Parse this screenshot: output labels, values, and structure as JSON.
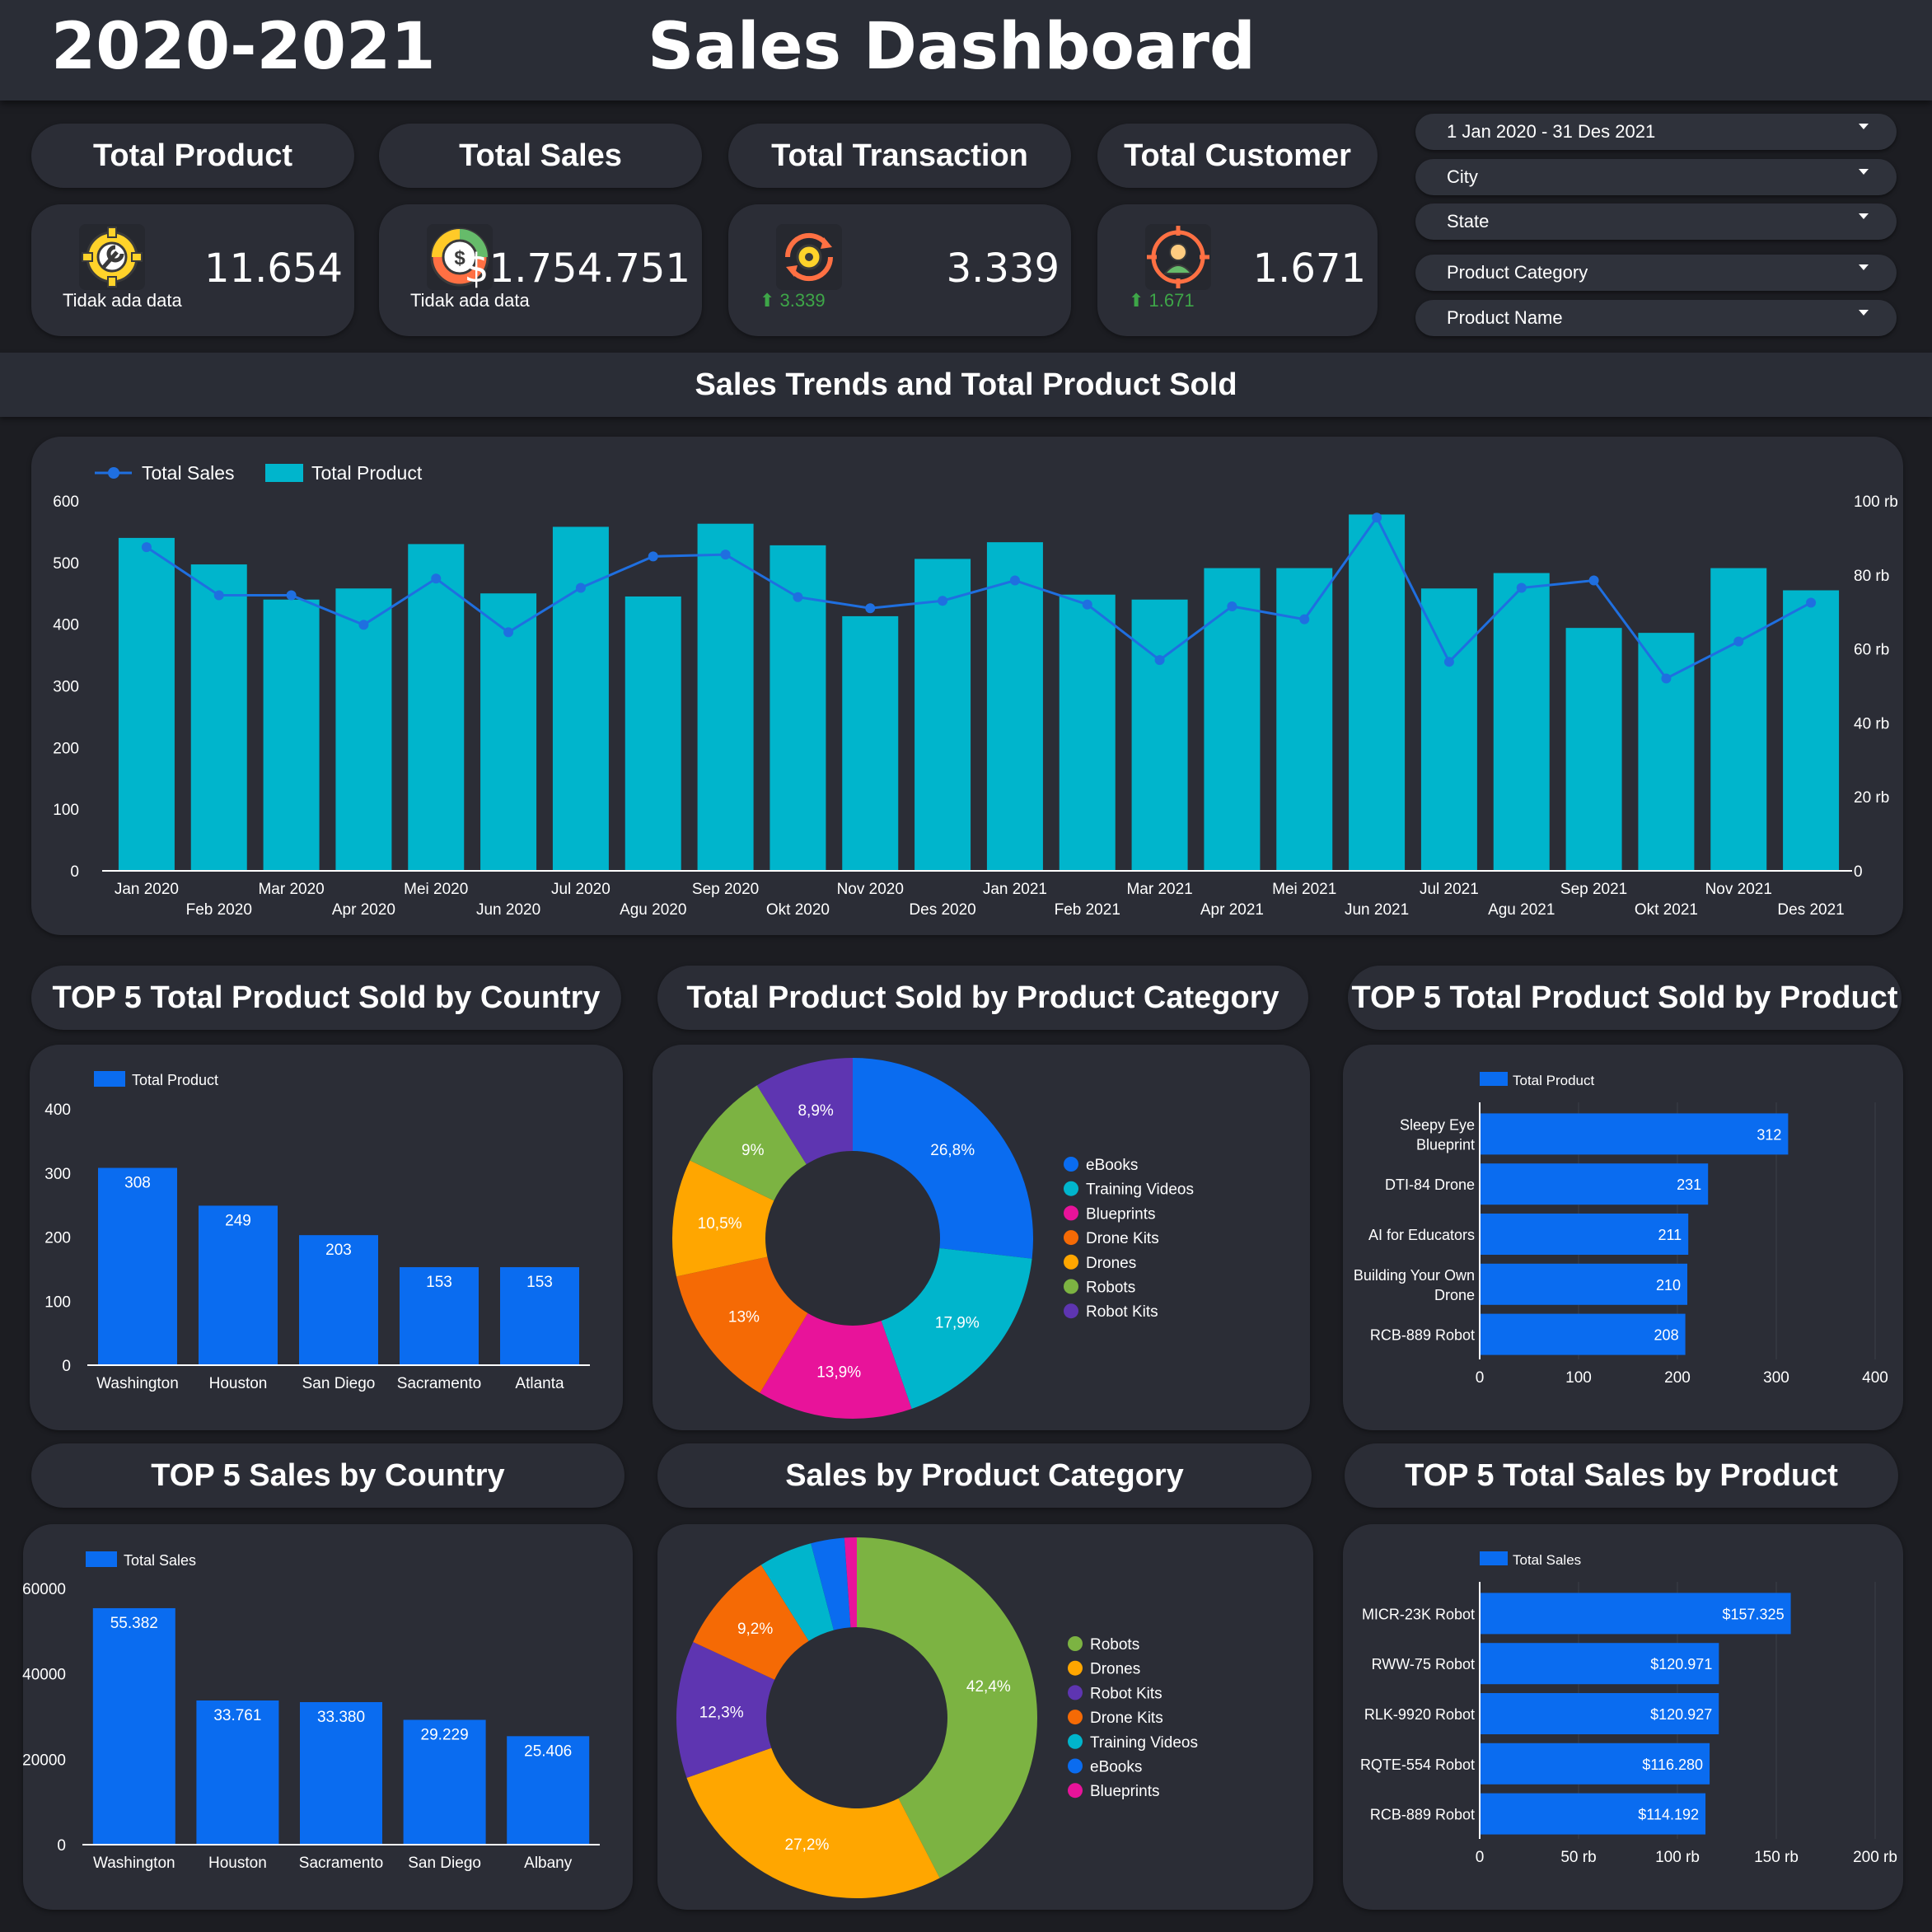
{
  "header": {
    "year": "2020-2021",
    "title": "Sales Dashboard"
  },
  "kpis": [
    {
      "title": "Total Product",
      "value": "11.654",
      "sub": "Tidak ada data",
      "icon": "gear-wrench-icon"
    },
    {
      "title": "Total Sales",
      "value": "$1.754.751",
      "sub": "Tidak ada data",
      "icon": "dollar-coin-icon"
    },
    {
      "title": "Total Transaction",
      "value": "3.339",
      "sub": "3.339",
      "icon": "gear-cycle-icon"
    },
    {
      "title": "Total Customer",
      "value": "1.671",
      "sub": "1.671",
      "icon": "customer-target-icon"
    }
  ],
  "filters": [
    "1 Jan 2020 - 31 Des 2021",
    "City",
    "State",
    "Product Category",
    "Product Name"
  ],
  "section_title": "Sales Trends and Total Product Sold",
  "colors": {
    "bar_cyan": "#00b5cc",
    "bar_blue": "#0a6cf0",
    "line_blue": "#1f6fe0",
    "card": "#2b2d36",
    "bg": "#1c1d22",
    "up_green": "#3ea648"
  },
  "chart_titles": {
    "country_product": "TOP 5 Total Product Sold by Country",
    "category_product": "Total Product Sold by  Product Category",
    "product_product": "TOP 5 Total Product Sold by Product",
    "country_sales": "TOP 5 Sales by Country",
    "category_sales": "Sales by Product Category",
    "product_sales": "TOP 5 Total Sales by Product"
  },
  "chart_data": [
    {
      "type": "bar",
      "legend": [
        "Total Sales",
        "Total Product"
      ],
      "categories": [
        "Jan 2020",
        "Feb 2020",
        "Mar 2020",
        "Apr 2020",
        "Mei 2020",
        "Jun 2020",
        "Jul 2020",
        "Agu 2020",
        "Sep 2020",
        "Okt 2020",
        "Nov 2020",
        "Des 2020",
        "Jan 2021",
        "Feb 2021",
        "Mar 2021",
        "Apr 2021",
        "Mei 2021",
        "Jun 2021",
        "Jul 2021",
        "Agu 2021",
        "Sep 2021",
        "Okt 2021",
        "Nov 2021",
        "Des 2021"
      ],
      "series": [
        {
          "name": "Total Product",
          "axis": "left",
          "values": [
            540,
            497,
            440,
            458,
            530,
            450,
            558,
            445,
            563,
            528,
            413,
            506,
            533,
            448,
            440,
            491,
            491,
            578,
            458,
            483,
            394,
            386,
            491,
            455
          ]
        },
        {
          "name": "Total Sales",
          "axis": "right",
          "values": [
            87500,
            74500,
            74500,
            66500,
            79000,
            64500,
            76500,
            85000,
            85500,
            74000,
            71000,
            73000,
            78500,
            72000,
            57000,
            71500,
            68000,
            95500,
            56500,
            76500,
            78500,
            52000,
            62000,
            72500
          ]
        }
      ],
      "y_ticks": [
        "0",
        "100",
        "200",
        "300",
        "400",
        "500",
        "600"
      ],
      "y2_ticks": [
        "0",
        "20 rb",
        "40 rb",
        "60 rb",
        "80 rb",
        "100 rb"
      ],
      "ylim": [
        0,
        600
      ],
      "y2lim": [
        0,
        100000
      ],
      "legend_position": "top-left"
    },
    {
      "type": "bar",
      "legend": [
        "Total Product"
      ],
      "categories": [
        "Washington",
        "Houston",
        "San Diego",
        "Sacramento",
        "Atlanta"
      ],
      "values": [
        308,
        249,
        203,
        153,
        153
      ],
      "labels": [
        "308",
        "249",
        "203",
        "153",
        "153"
      ],
      "y_ticks": [
        "0",
        "100",
        "200",
        "300",
        "400"
      ],
      "ylim": [
        0,
        400
      ]
    },
    {
      "type": "pie",
      "slices": [
        {
          "name": "eBooks",
          "value": 26.8,
          "label": "26,8%",
          "color": "#0a6cf0"
        },
        {
          "name": "Training Videos",
          "value": 17.9,
          "label": "17,9%",
          "color": "#00b5cc"
        },
        {
          "name": "Blueprints",
          "value": 13.9,
          "label": "13,9%",
          "color": "#e8139a"
        },
        {
          "name": "Drone Kits",
          "value": 13.0,
          "label": "13%",
          "color": "#f56a05"
        },
        {
          "name": "Drones",
          "value": 10.5,
          "label": "10,5%",
          "color": "#ffa600"
        },
        {
          "name": "Robots",
          "value": 9.0,
          "label": "9%",
          "color": "#7cb342"
        },
        {
          "name": "Robot Kits",
          "value": 8.9,
          "label": "8,9%",
          "color": "#5e35b1"
        }
      ]
    },
    {
      "type": "bar",
      "orientation": "horizontal",
      "legend": [
        "Total Product"
      ],
      "categories": [
        [
          "Sleepy Eye",
          "Blueprint"
        ],
        [
          "DTI-84 Drone"
        ],
        [
          "AI for Educators"
        ],
        [
          "Building Your Own",
          "Drone"
        ],
        [
          "RCB-889 Robot"
        ]
      ],
      "values": [
        312,
        231,
        211,
        210,
        208
      ],
      "labels": [
        "312",
        "231",
        "211",
        "210",
        "208"
      ],
      "x_ticks": [
        "0",
        "100",
        "200",
        "300",
        "400"
      ],
      "xlim": [
        0,
        400
      ]
    },
    {
      "type": "bar",
      "legend": [
        "Total Sales"
      ],
      "categories": [
        "Washington",
        "Houston",
        "Sacramento",
        "San Diego",
        "Albany"
      ],
      "values": [
        55382,
        33761,
        33380,
        29229,
        25406
      ],
      "labels": [
        "55.382",
        "33.761",
        "33.380",
        "29.229",
        "25.406"
      ],
      "y_ticks": [
        "0",
        "20000",
        "40000",
        "60000"
      ],
      "ylim": [
        0,
        60000
      ]
    },
    {
      "type": "pie",
      "slices": [
        {
          "name": "Robots",
          "value": 42.4,
          "label": "42,4%",
          "color": "#7cb342"
        },
        {
          "name": "Drones",
          "value": 27.2,
          "label": "27,2%",
          "color": "#ffa600"
        },
        {
          "name": "Robot Kits",
          "value": 12.3,
          "label": "12,3%",
          "color": "#5e35b1"
        },
        {
          "name": "Drone Kits",
          "value": 9.2,
          "label": "9,2%",
          "color": "#f56a05"
        },
        {
          "name": "Training Videos",
          "value": 4.8,
          "label": "",
          "color": "#00b5cc"
        },
        {
          "name": "eBooks",
          "value": 3.0,
          "label": "",
          "color": "#0a6cf0"
        },
        {
          "name": "Blueprints",
          "value": 1.1,
          "label": "",
          "color": "#e8139a"
        }
      ]
    },
    {
      "type": "bar",
      "orientation": "horizontal",
      "legend": [
        "Total Sales"
      ],
      "categories": [
        [
          "MICR-23K Robot"
        ],
        [
          "RWW-75 Robot"
        ],
        [
          "RLK-9920 Robot"
        ],
        [
          "RQTE-554 Robot"
        ],
        [
          "RCB-889 Robot"
        ]
      ],
      "values": [
        157325,
        120971,
        120927,
        116280,
        114192
      ],
      "labels": [
        "$157.325",
        "$120.971",
        "$120.927",
        "$116.280",
        "$114.192"
      ],
      "x_ticks": [
        "0",
        "50 rb",
        "100 rb",
        "150 rb",
        "200 rb"
      ],
      "xlim": [
        0,
        200000
      ]
    }
  ]
}
